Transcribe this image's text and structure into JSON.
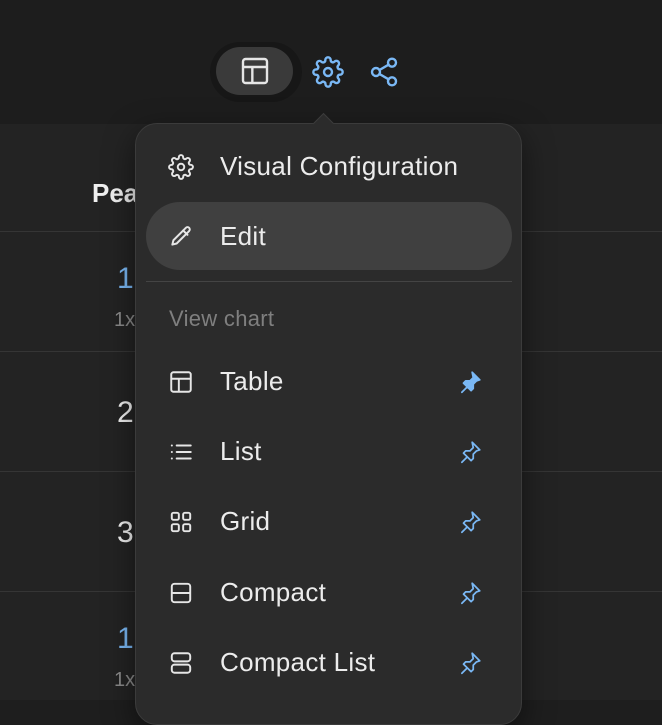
{
  "toolbar": {
    "buttons": [
      {
        "icon": "table-icon",
        "active": true
      },
      {
        "icon": "gear-icon",
        "active": false
      },
      {
        "icon": "share-icon",
        "active": false
      }
    ],
    "accent_color": "#7ab8f5"
  },
  "table": {
    "column_header": "Pea",
    "rows": [
      {
        "value": "1",
        "sub": "1x",
        "accent": true
      },
      {
        "value": "2",
        "sub": "",
        "accent": false
      },
      {
        "value": "3",
        "sub": "",
        "accent": false
      },
      {
        "value": "1",
        "sub": "1x",
        "accent": true
      }
    ]
  },
  "menu": {
    "items": [
      {
        "label": "Visual Configuration",
        "icon": "gear-icon"
      },
      {
        "label": "Edit",
        "icon": "pencil-icon",
        "highlighted": true
      }
    ],
    "section_label": "View chart",
    "view_options": [
      {
        "label": "Table",
        "icon": "table-icon",
        "pinned": true
      },
      {
        "label": "List",
        "icon": "list-icon",
        "pinned": false
      },
      {
        "label": "Grid",
        "icon": "grid-icon",
        "pinned": false
      },
      {
        "label": "Compact",
        "icon": "compact-icon",
        "pinned": false
      },
      {
        "label": "Compact List",
        "icon": "compact-list-icon",
        "pinned": false
      }
    ]
  }
}
